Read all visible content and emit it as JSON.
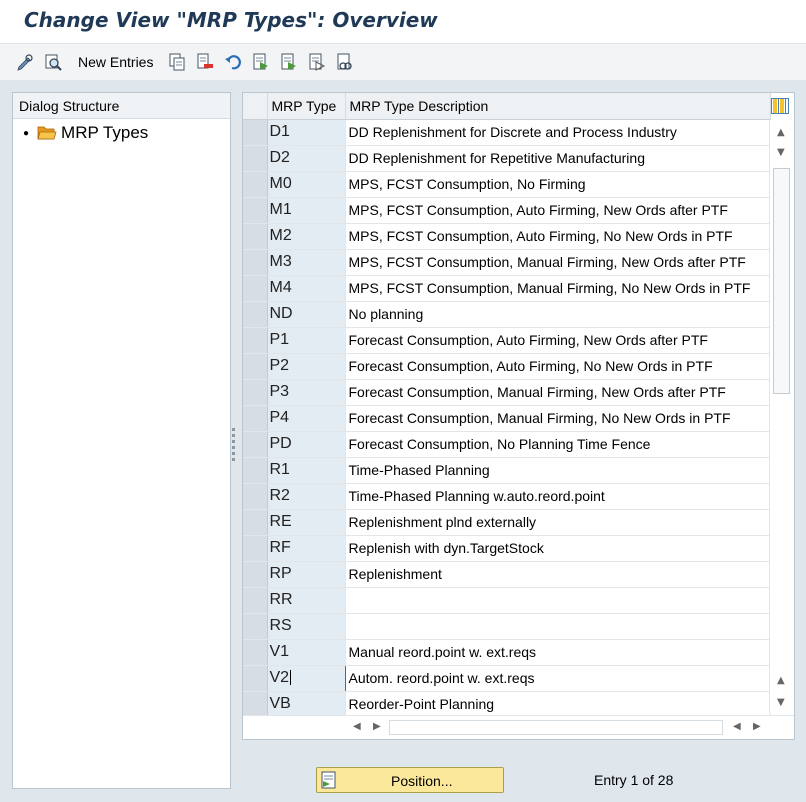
{
  "window": {
    "title": "Change View \"MRP Types\": Overview"
  },
  "toolbar": {
    "new_entries_label": "New Entries",
    "icons": [
      "display-change-icon",
      "find-icon",
      "copy-icon",
      "delete-icon",
      "undo-icon",
      "select-all-icon",
      "select-block-icon",
      "deselect-all-icon",
      "configure-icon"
    ]
  },
  "dialog_structure": {
    "header": "Dialog Structure",
    "items": [
      {
        "label": "MRP Types",
        "icon": "folder-open-icon"
      }
    ]
  },
  "table": {
    "columns": {
      "type": "MRP Type",
      "description": "MRP Type Description"
    },
    "rows": [
      {
        "type": "D1",
        "description": "DD Replenishment for Discrete and Process Industry"
      },
      {
        "type": "D2",
        "description": "DD Replenishment for Repetitive Manufacturing"
      },
      {
        "type": "M0",
        "description": "MPS, FCST Consumption, No Firming"
      },
      {
        "type": "M1",
        "description": "MPS, FCST Consumption, Auto Firming, New Ords after PTF"
      },
      {
        "type": "M2",
        "description": "MPS, FCST Consumption, Auto Firming, No New Ords in PTF"
      },
      {
        "type": "M3",
        "description": "MPS, FCST Consumption, Manual Firming, New Ords after PTF"
      },
      {
        "type": "M4",
        "description": "MPS, FCST Consumption, Manual Firming, No New Ords in PTF"
      },
      {
        "type": "ND",
        "description": "No planning"
      },
      {
        "type": "P1",
        "description": "Forecast Consumption, Auto Firming, New Ords after PTF"
      },
      {
        "type": "P2",
        "description": "Forecast Consumption, Auto Firming, No New Ords in PTF"
      },
      {
        "type": "P3",
        "description": "Forecast Consumption, Manual Firming, New Ords after PTF"
      },
      {
        "type": "P4",
        "description": "Forecast Consumption, Manual Firming, No New Ords in PTF"
      },
      {
        "type": "PD",
        "description": "Forecast Consumption, No Planning Time Fence"
      },
      {
        "type": "R1",
        "description": "Time-Phased Planning"
      },
      {
        "type": "R2",
        "description": "Time-Phased Planning w.auto.reord.point"
      },
      {
        "type": "RE",
        "description": "Replenishment plnd externally"
      },
      {
        "type": "RF",
        "description": "Replenish with dyn.TargetStock"
      },
      {
        "type": "RP",
        "description": "Replenishment"
      },
      {
        "type": "RR",
        "description": ""
      },
      {
        "type": "RS",
        "description": ""
      },
      {
        "type": "V1",
        "description": "Manual reord.point w. ext.reqs"
      },
      {
        "type": "V2",
        "description": "Autom. reord.point w. ext.reqs"
      },
      {
        "type": "VB",
        "description": "Reorder-Point Planning"
      }
    ],
    "focused_row_type": "V2"
  },
  "footer": {
    "position_label": "Position...",
    "entry_info": "Entry 1 of 28"
  },
  "colors": {
    "title_text": "#1f3956",
    "key_cell_bg": "#e4ecf3",
    "position_button_bg": "#fbe89a",
    "focus_border": "#dd3333"
  }
}
